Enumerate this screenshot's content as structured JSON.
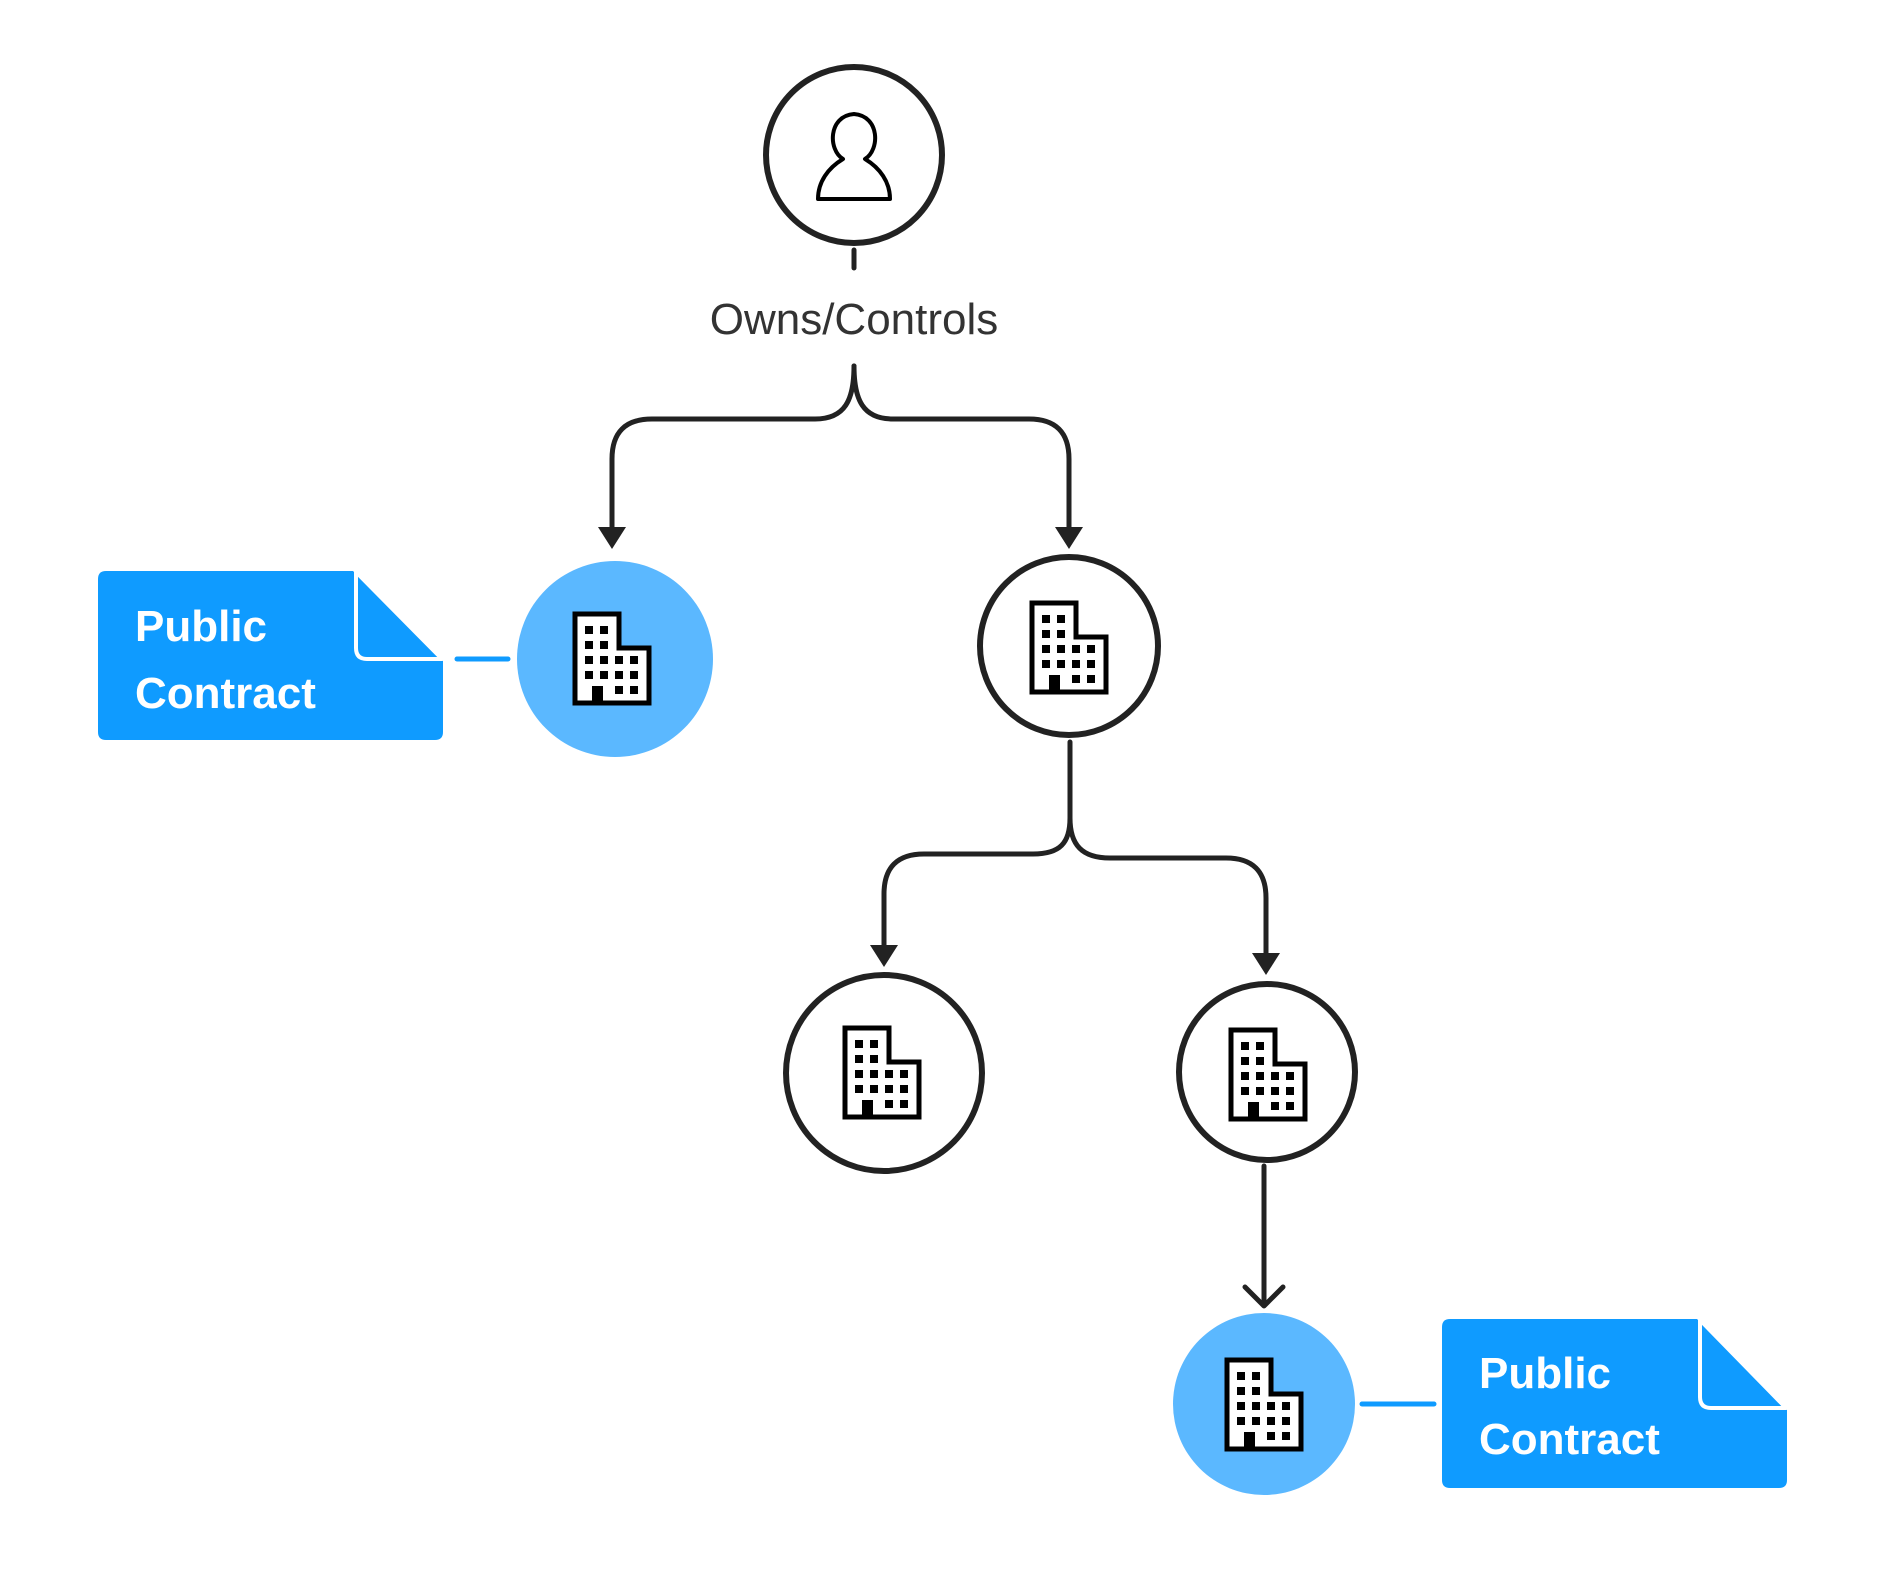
{
  "diagram": {
    "title": "",
    "colors": {
      "stroke": "#222222",
      "label_text": "#333333",
      "highlight_node_fill": "#5BB8FF",
      "document_fill": "#0F9BFF",
      "document_text": "#FFFFFF",
      "node_fill": "#FFFFFF"
    },
    "nodes": [
      {
        "id": "owner",
        "type": "person",
        "icon": "person-icon",
        "highlighted": false
      },
      {
        "id": "company-a",
        "type": "company",
        "icon": "building-icon",
        "highlighted": true
      },
      {
        "id": "company-b",
        "type": "company",
        "icon": "building-icon",
        "highlighted": false
      },
      {
        "id": "company-c",
        "type": "company",
        "icon": "building-icon",
        "highlighted": false
      },
      {
        "id": "company-d",
        "type": "company",
        "icon": "building-icon",
        "highlighted": false
      },
      {
        "id": "company-e",
        "type": "company",
        "icon": "building-icon",
        "highlighted": true
      }
    ],
    "edges": [
      {
        "from": "owner",
        "to": "company-a",
        "label": "Owns/Controls"
      },
      {
        "from": "owner",
        "to": "company-b",
        "label": "Owns/Controls"
      },
      {
        "from": "company-b",
        "to": "company-c"
      },
      {
        "from": "company-b",
        "to": "company-d"
      },
      {
        "from": "company-d",
        "to": "company-e"
      }
    ],
    "edge_label": "Owns/Controls",
    "documents": [
      {
        "attached_to": "company-a",
        "line1": "Public",
        "line2": "Contract",
        "icon": "document-icon"
      },
      {
        "attached_to": "company-e",
        "line1": "Public",
        "line2": "Contract",
        "icon": "document-icon"
      }
    ]
  }
}
